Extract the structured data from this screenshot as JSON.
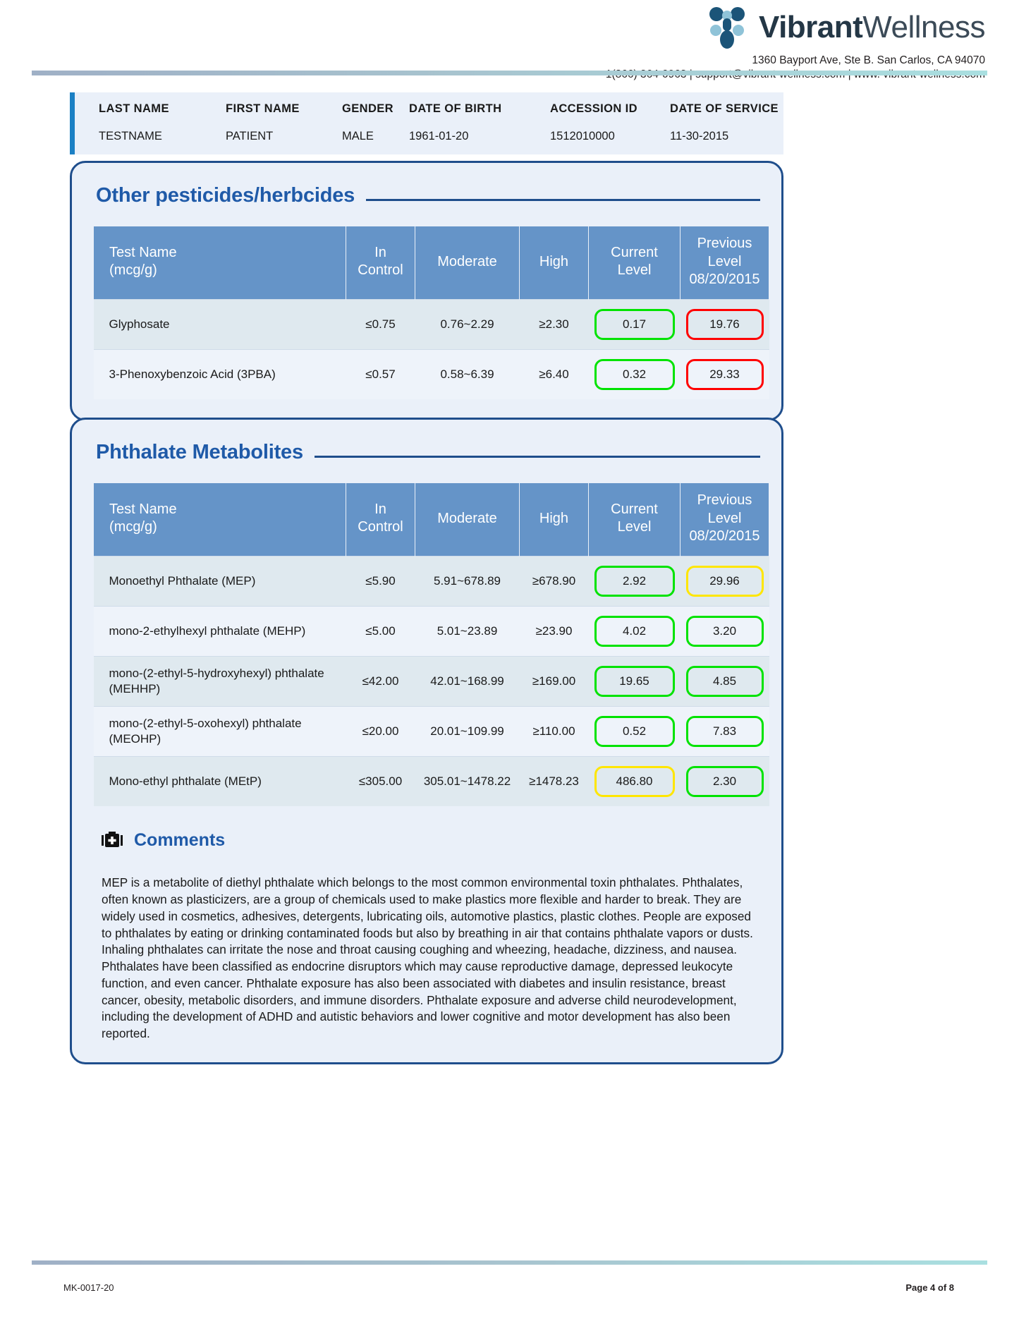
{
  "brand": {
    "name_bold": "Vibrant",
    "name_light": "Wellness",
    "address": "1360 Bayport Ave, Ste B. San Carlos, CA 94070",
    "contact": "1(866) 364-0963 | support@vibrant-wellness.com | www. vibrant-wellness.com",
    "logo_icon": "vibrant-molecule-logo"
  },
  "patient": {
    "headers": [
      "LAST NAME",
      "FIRST NAME",
      "GENDER",
      "DATE OF BIRTH",
      "ACCESSION ID",
      "DATE OF SERVICE"
    ],
    "values": [
      "TESTNAME",
      "PATIENT",
      "MALE",
      "1961-01-20",
      "1512010000",
      "11-30-2015"
    ]
  },
  "columns": {
    "name": "Test Name",
    "name_unit": "(mcg/g)",
    "in_control_l1": "In",
    "in_control_l2": "Control",
    "moderate": "Moderate",
    "high": "High",
    "current_l1": "Current",
    "current_l2": "Level",
    "previous_l1": "Previous",
    "previous_l2": "Level",
    "previous_l3": "08/20/2015"
  },
  "sections": [
    {
      "title": "Other pesticides/herbcides",
      "rows": [
        {
          "name": "Glyphosate",
          "in_control": "≤0.75",
          "moderate": "0.76~2.29",
          "high": "≥2.30",
          "current": "0.17",
          "current_status": "green",
          "previous": "19.76",
          "previous_status": "red"
        },
        {
          "name": "3-Phenoxybenzoic Acid (3PBA)",
          "in_control": "≤0.57",
          "moderate": "0.58~6.39",
          "high": "≥6.40",
          "current": "0.32",
          "current_status": "green",
          "previous": "29.33",
          "previous_status": "red"
        }
      ]
    },
    {
      "title": "Phthalate Metabolites",
      "rows": [
        {
          "name": "Monoethyl Phthalate (MEP)",
          "in_control": "≤5.90",
          "moderate": "5.91~678.89",
          "high": "≥678.90",
          "current": "2.92",
          "current_status": "green",
          "previous": "29.96",
          "previous_status": "yellow"
        },
        {
          "name": "mono-2-ethylhexyl phthalate (MEHP)",
          "in_control": "≤5.00",
          "moderate": "5.01~23.89",
          "high": "≥23.90",
          "current": "4.02",
          "current_status": "green",
          "previous": "3.20",
          "previous_status": "green"
        },
        {
          "name": "mono-(2-ethyl-5-hydroxyhexyl) phthalate (MEHHP)",
          "in_control": "≤42.00",
          "moderate": "42.01~168.99",
          "high": "≥169.00",
          "current": "19.65",
          "current_status": "green",
          "previous": "4.85",
          "previous_status": "green"
        },
        {
          "name": "mono-(2-ethyl-5-oxohexyl) phthalate (MEOHP)",
          "in_control": "≤20.00",
          "moderate": "20.01~109.99",
          "high": "≥110.00",
          "current": "0.52",
          "current_status": "green",
          "previous": "7.83",
          "previous_status": "green"
        },
        {
          "name": "Mono-ethyl phthalate (MEtP)",
          "in_control": "≤305.00",
          "moderate": "305.01~1478.22",
          "high": "≥1478.23",
          "current": "486.80",
          "current_status": "yellow",
          "previous": "2.30",
          "previous_status": "green"
        }
      ]
    }
  ],
  "comments": {
    "icon": "medical-bag-icon",
    "title": "Comments",
    "text": "MEP is a metabolite of diethyl phthalate which belongs to the most common environmental toxin phthalates. Phthalates, often known as plasticizers, are a group of chemicals used to make plastics more flexible and harder to break. They are widely used in cosmetics, adhesives, detergents, lubricating oils, automotive plastics, plastic clothes. People are exposed to phthalates by eating or drinking contaminated foods but also by breathing in air that contains phthalate vapors or dusts. Inhaling phthalates can irritate the nose and throat causing coughing and wheezing, headache, dizziness, and nausea. Phthalates have been classified as endocrine disruptors which may cause reproductive damage, depressed leukocyte function, and even cancer. Phthalate exposure has also been associated with diabetes and insulin resistance, breast cancer, obesity, metabolic disorders, and immune disorders. Phthalate exposure and adverse child neurodevelopment, including the development of ADHD and autistic behaviors and lower cognitive and motor development has also been reported."
  },
  "footer": {
    "doc_code": "MK-0017-20",
    "page_label": "Page 4 of 8"
  },
  "colors": {
    "header_blue": "#6594c8",
    "panel_border": "#1f4e8c",
    "title_blue": "#1f5aa8",
    "status_green": "#00e300",
    "status_yellow": "#ffe600",
    "status_red": "#ff0000",
    "accent_bar": "#1b80c4"
  }
}
